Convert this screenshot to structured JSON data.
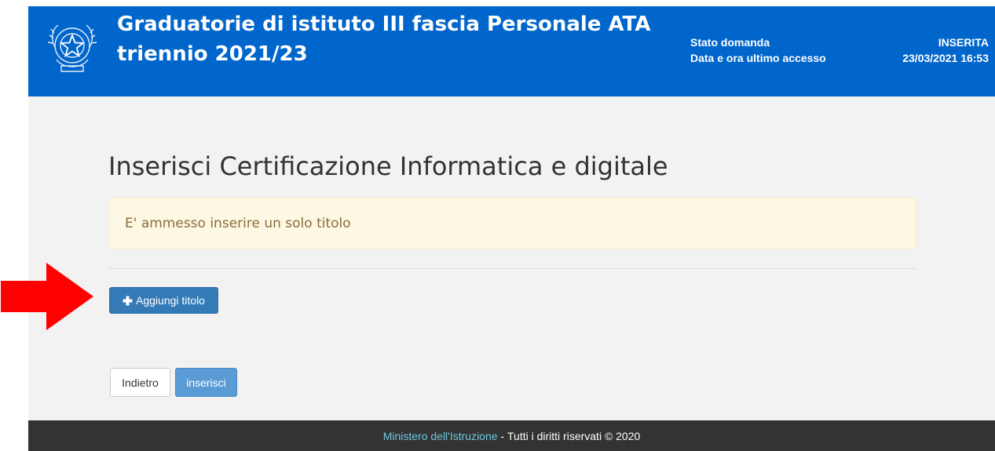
{
  "header": {
    "title_line1": "Graduatorie di istituto III fascia Personale ATA",
    "title_line2": "triennio 2021/23",
    "status_label": "Stato domanda",
    "status_value": "INSERITA",
    "last_access_label": "Data e ora ultimo accesso",
    "last_access_value": "23/03/2021 16:53",
    "emblem_icon": "republic-emblem-icon"
  },
  "main": {
    "page_title": "Inserisci Certificazione Informatica e digitale",
    "alert_text": "E' ammesso inserire un solo titolo",
    "add_button_icon": "plus-icon",
    "add_button_label": "Aggiungi titolo",
    "back_button_label": "Indietro",
    "submit_button_label": "inserisci"
  },
  "footer": {
    "ministry_link": "Ministero dell'Istruzione",
    "separator": " - ",
    "rights_text": "Tutti i diritti riservati © 2020"
  },
  "annotation": {
    "arrow_icon": "red-arrow-right-icon"
  },
  "colors": {
    "header_bg": "#0066cc",
    "page_bg": "#f2f2f2",
    "alert_bg": "#fcf8e3",
    "alert_text": "#8a6d3b",
    "primary_button": "#337ab7",
    "submit_button": "#5b9bd5",
    "footer_bg": "#333333",
    "footer_link": "#6fc8e0",
    "arrow": "#ff0000"
  }
}
